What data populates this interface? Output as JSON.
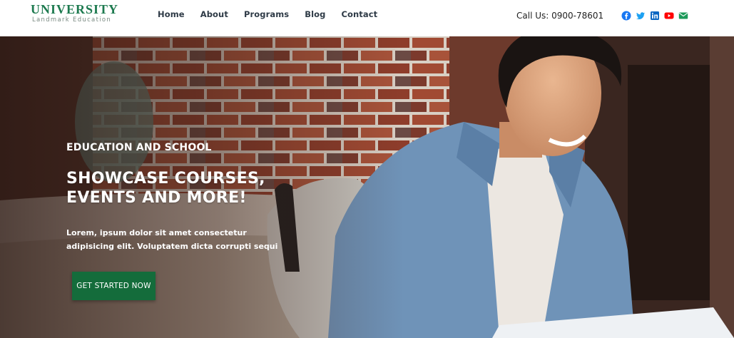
{
  "brand": {
    "title": "UNIVERSITY",
    "subtitle": "Landmark Education",
    "color": "#1d7a4f"
  },
  "nav": {
    "items": [
      {
        "label": "Home"
      },
      {
        "label": "About"
      },
      {
        "label": "Programs"
      },
      {
        "label": "Blog"
      },
      {
        "label": "Contact"
      }
    ]
  },
  "contact": {
    "phone": "Call Us: 0900-78601"
  },
  "social": [
    {
      "name": "facebook-icon",
      "color": "#1877f2"
    },
    {
      "name": "twitter-icon",
      "color": "#1da1f2"
    },
    {
      "name": "linkedin-icon",
      "color": "#0a66c2"
    },
    {
      "name": "youtube-icon",
      "color": "#ff0000"
    },
    {
      "name": "email-icon",
      "color": "#1d9a5a"
    }
  ],
  "hero": {
    "eyebrow": "EDUCATION AND SCHOOL",
    "title": "SHOWCASE COURSES, EVENTS AND MORE!",
    "description": "Lorem, ipsum dolor sit amet consectetur adipisicing elit. Voluptatem dicta corrupti sequi",
    "cta_label": "GET STARTED NOW",
    "cta_color": "#146c3b"
  }
}
